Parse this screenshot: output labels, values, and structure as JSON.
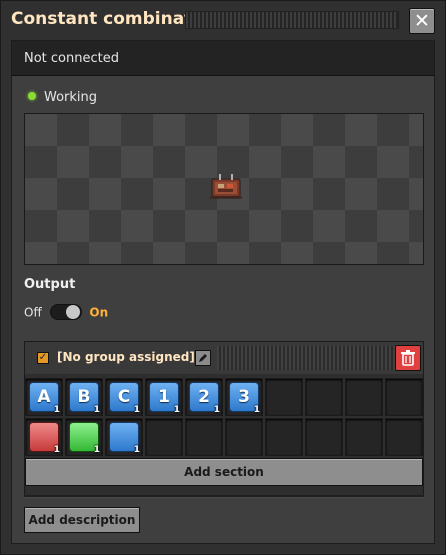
{
  "window": {
    "title": "Constant combinator",
    "close_icon": "close-icon"
  },
  "status": {
    "connection": "Not connected",
    "working_label": "Working",
    "working_color": "#8ade30"
  },
  "output": {
    "label": "Output",
    "switch_off": "Off",
    "switch_on": "On",
    "state": "on"
  },
  "section": {
    "enabled": true,
    "group_label": "[No group assigned]",
    "signals": [
      {
        "label": "A",
        "count": "1",
        "kind": "letter"
      },
      {
        "label": "B",
        "count": "1",
        "kind": "letter"
      },
      {
        "label": "C",
        "count": "1",
        "kind": "letter"
      },
      {
        "label": "1",
        "count": "1",
        "kind": "digit"
      },
      {
        "label": "2",
        "count": "1",
        "kind": "digit"
      },
      {
        "label": "3",
        "count": "1",
        "kind": "digit"
      },
      {
        "label": "",
        "count": "1",
        "kind": "red-signal",
        "color": "#e05555"
      },
      {
        "label": "",
        "count": "1",
        "kind": "green-signal",
        "color": "#4fd24f"
      },
      {
        "label": "",
        "count": "1",
        "kind": "blue-signal",
        "color": "#3f8fe0"
      }
    ],
    "add_section_label": "Add section"
  },
  "footer": {
    "add_description_label": "Add description"
  },
  "colors": {
    "accent": "#ffb23a",
    "danger": "#e04040",
    "title": "#ffe6c0"
  }
}
